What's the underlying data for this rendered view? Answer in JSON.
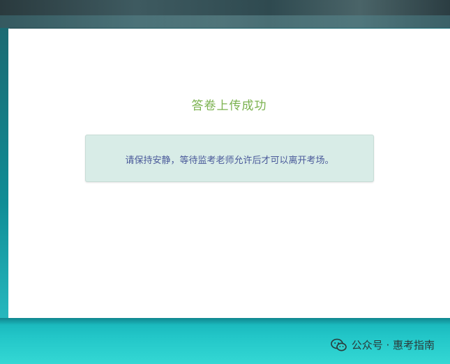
{
  "page": {
    "title": "答卷上传成功",
    "notice": "请保持安静，等待监考老师允许后才可以离开考场。"
  },
  "watermark": {
    "text": "公众号 · 惠考指南",
    "icon": "wechat-icon"
  },
  "colors": {
    "title": "#7bb24f",
    "notice_text": "#4a5a9a",
    "notice_bg": "#d8ece7"
  }
}
